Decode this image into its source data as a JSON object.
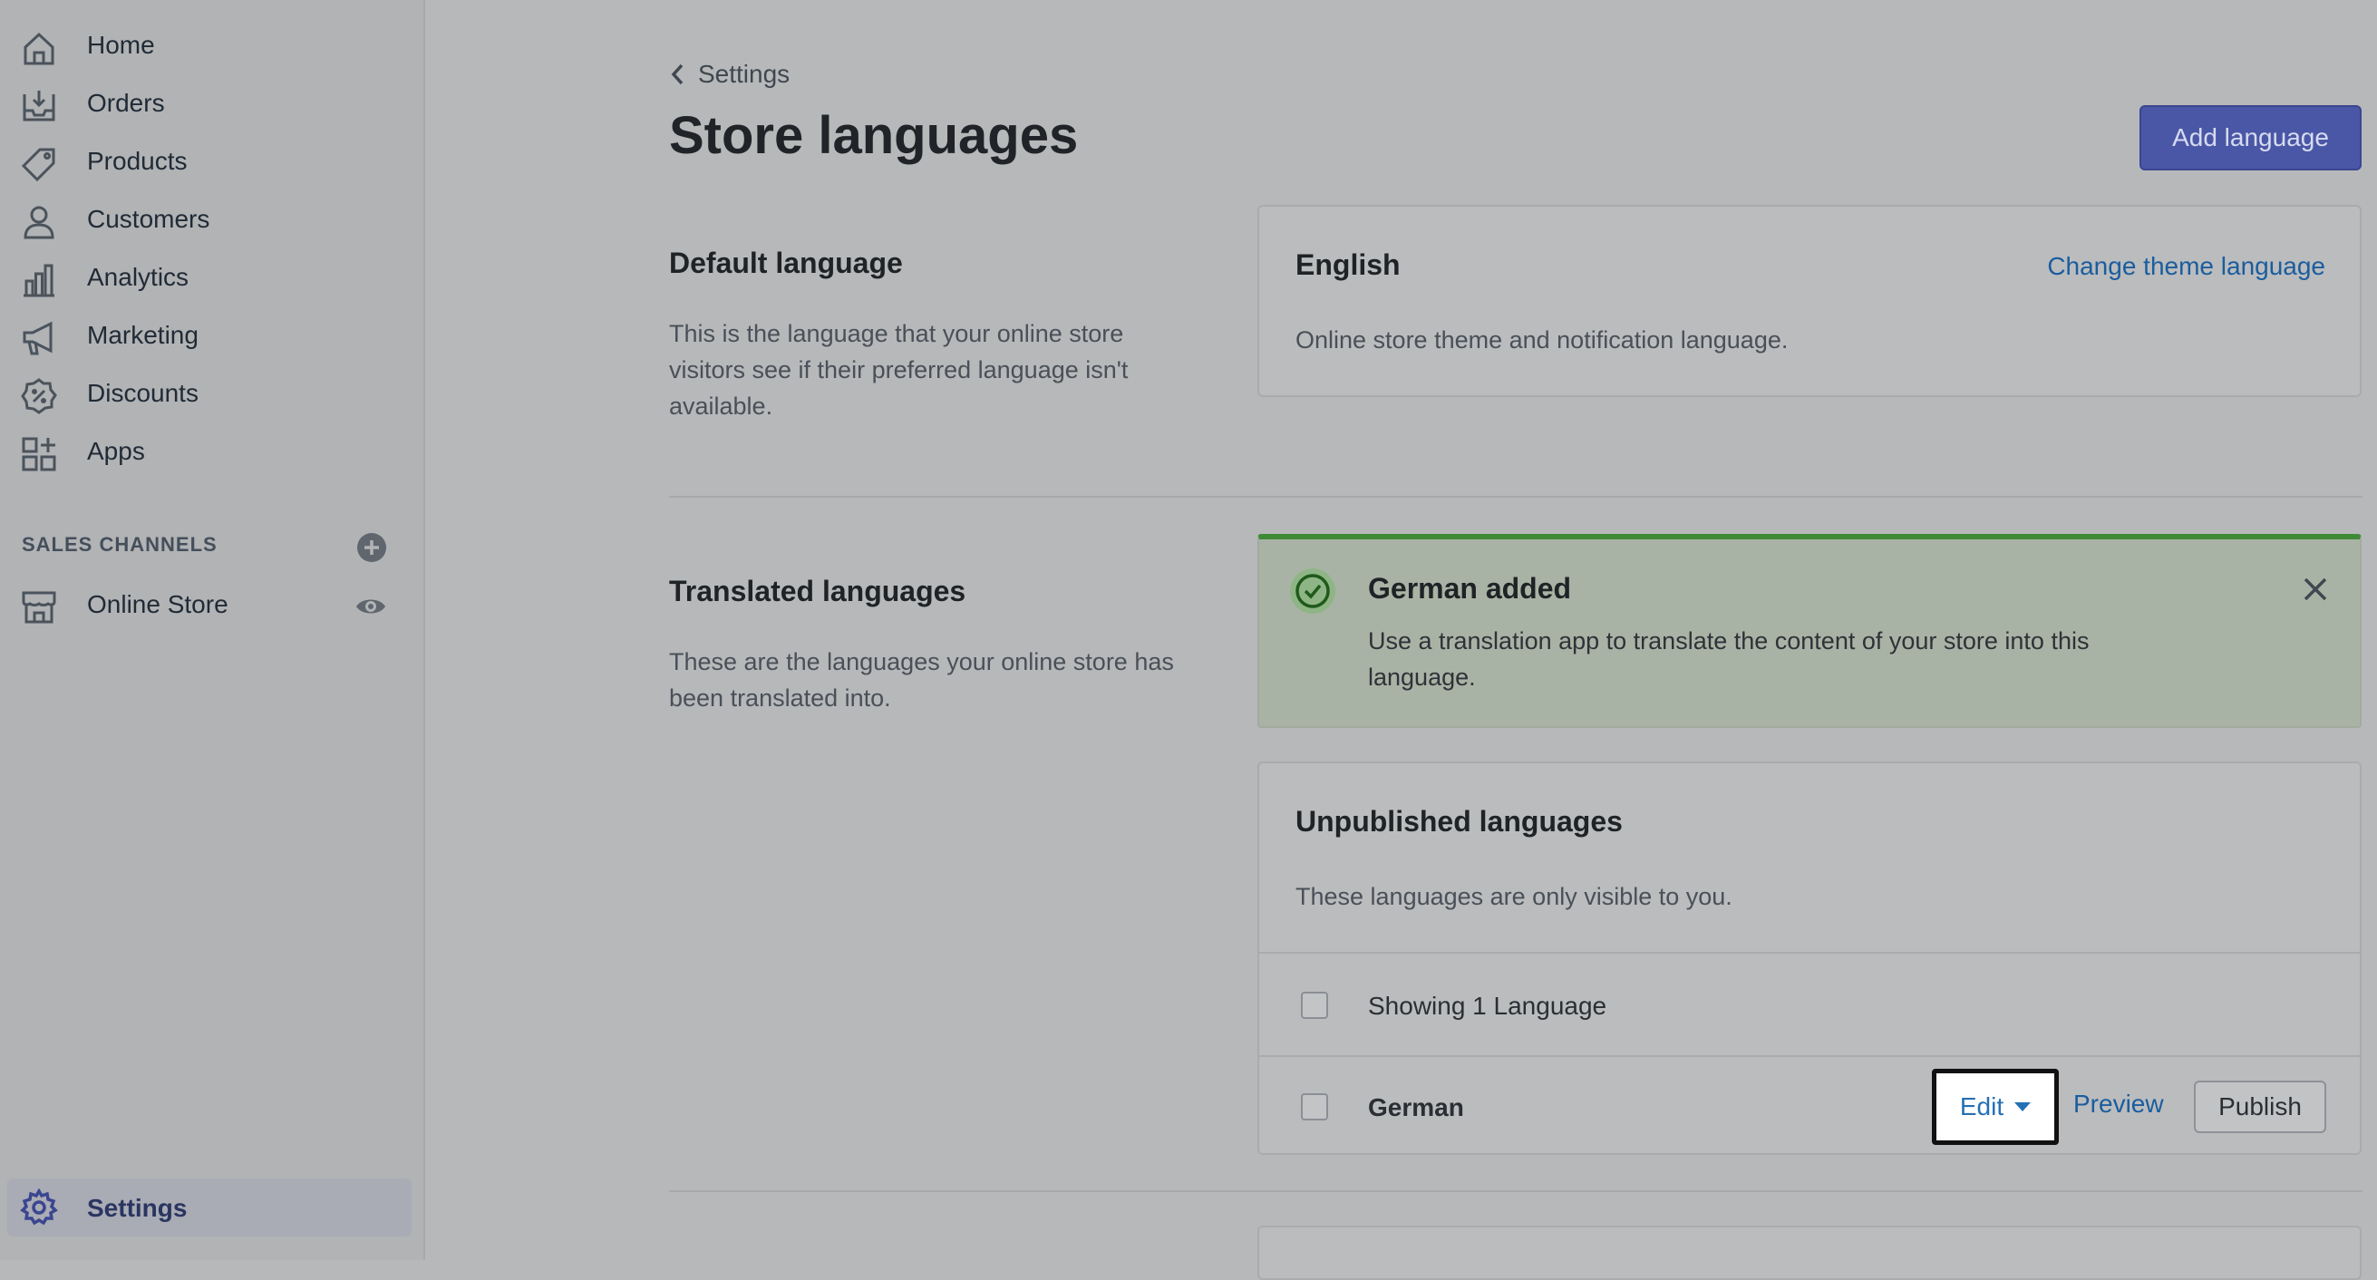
{
  "sidebar": {
    "items": [
      {
        "label": "Home",
        "icon": "home-icon"
      },
      {
        "label": "Orders",
        "icon": "orders-icon"
      },
      {
        "label": "Products",
        "icon": "tag-icon"
      },
      {
        "label": "Customers",
        "icon": "person-icon"
      },
      {
        "label": "Analytics",
        "icon": "bar-chart-icon"
      },
      {
        "label": "Marketing",
        "icon": "megaphone-icon"
      },
      {
        "label": "Discounts",
        "icon": "discount-icon"
      },
      {
        "label": "Apps",
        "icon": "apps-icon"
      }
    ],
    "sales_channels_title": "SALES CHANNELS",
    "online_store_label": "Online Store",
    "settings_label": "Settings"
  },
  "header": {
    "breadcrumb": "Settings",
    "title": "Store languages",
    "add_button": "Add language"
  },
  "default_language": {
    "heading": "Default language",
    "description": "This is the language that your online store visitors see if their preferred language isn't available.",
    "card_title": "English",
    "card_link": "Change theme language",
    "card_text": "Online store theme and notification language."
  },
  "translated_languages": {
    "heading": "Translated languages",
    "description": "These are the languages your online store has been translated into.",
    "banner_title": "German added",
    "banner_text": "Use a translation app to translate the content of your store into this language.",
    "unpublished_title": "Unpublished languages",
    "unpublished_text": "These languages are only visible to you.",
    "showing_label": "Showing 1 Language",
    "row_language": "German",
    "edit_label": "Edit",
    "preview_label": "Preview",
    "publish_label": "Publish"
  },
  "colors": {
    "primary": "#4a57a6",
    "link": "#1a5d9e",
    "success": "#3f8a36"
  }
}
